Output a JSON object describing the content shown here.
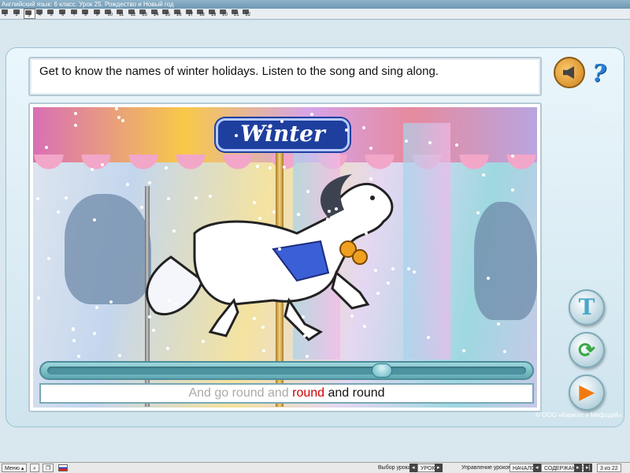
{
  "window": {
    "title": "Английский язык: 6 класс. Урок 25. Рождество и Новый год"
  },
  "lesson_tabs": [
    "1",
    "2",
    "3",
    "4",
    "5",
    "6",
    "7",
    "8",
    "9",
    "10",
    "11",
    "12",
    "13",
    "14",
    "15",
    "16",
    "17",
    "18",
    "19",
    "20",
    "21",
    "22"
  ],
  "instruction": "Get to know the names of winter holidays. Listen to the song and sing along.",
  "banner": "Winter",
  "player": {
    "progress": 0.7
  },
  "lyrics": {
    "sung": "And go round and ",
    "current": "round",
    "next": " and round"
  },
  "buttons": {
    "text_toggle": "T"
  },
  "copyright": "© ООО «Кирилл и Мефодий»",
  "bottom_bar": {
    "menu": "Меню",
    "lesson_select_label": "Выбор урока:",
    "lesson_select_value": "УРОК",
    "lesson_control_label": "Управление уроком:",
    "start": "НАЧАЛО",
    "contents": "СОДЕРЖАНИЕ",
    "page_counter": "3 из 22"
  },
  "colors": {
    "accent_red": "#d00000",
    "banner_blue": "#1e3f9e",
    "play_orange": "#f07a10"
  }
}
